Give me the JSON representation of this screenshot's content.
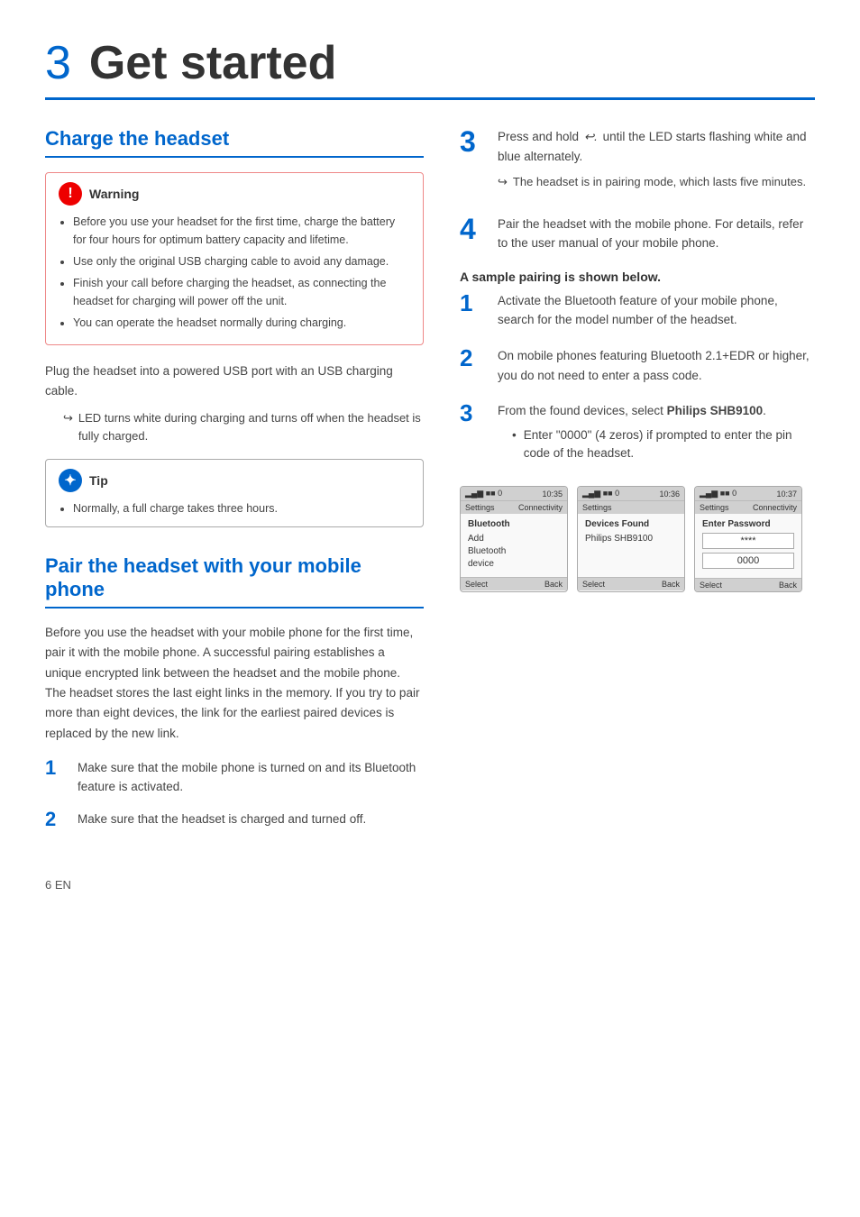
{
  "page": {
    "chapter": "3",
    "title": "Get started",
    "footer": "6    EN"
  },
  "charge_section": {
    "title": "Charge the headset",
    "warning": {
      "header": "Warning",
      "items": [
        "Before you use your headset for the first time, charge the battery for four hours for optimum battery capacity and lifetime.",
        "Use only the original USB charging cable to avoid any damage.",
        "Finish your call before charging the headset, as connecting the headset for charging will power off the unit.",
        "You can operate the headset normally during charging."
      ]
    },
    "body_text": "Plug the headset into a powered USB port with an USB charging cable.",
    "arrow_text": "LED turns white during charging and turns off when the headset is fully charged.",
    "tip": {
      "header": "Tip",
      "items": [
        "Normally, a full charge takes three hours."
      ]
    }
  },
  "right_steps": {
    "step3": {
      "num": "3",
      "text": "Press and hold",
      "icon_symbol": "↩",
      "text2": "until the LED starts flashing white and blue alternately.",
      "arrow": "The headset is in pairing mode, which lasts five minutes."
    },
    "step4": {
      "num": "4",
      "text": "Pair the headset with the mobile phone. For details, refer to the user manual of your mobile phone."
    },
    "sample_heading": "A sample pairing is shown below.",
    "sample_steps": [
      {
        "num": "1",
        "text": "Activate the Bluetooth feature of your mobile phone, search for the model number of the headset."
      },
      {
        "num": "2",
        "text": "On mobile phones featuring Bluetooth 2.1+EDR or higher, you do not need to enter a pass code."
      },
      {
        "num": "3",
        "text": "From the found devices, select",
        "bold_text": "Philips SHB9100",
        "text_after": "."
      }
    ],
    "pin_bullet": "Enter \"0000\" (4 zeros) if prompted to enter the pin code of the headset.",
    "phones": [
      {
        "time": "10:35",
        "nav_left": "Settings",
        "nav_right": "Connectivity",
        "section": "Bluetooth",
        "body_lines": [
          "Add",
          "Bluetooth",
          "device"
        ],
        "footer_left": "Select",
        "footer_right": "Back"
      },
      {
        "time": "10:36",
        "nav_left": "Settings",
        "nav_right": "",
        "section": "Devices Found",
        "body_lines": [
          "Philips SHB9100"
        ],
        "footer_left": "Select",
        "footer_right": "Back"
      },
      {
        "time": "10:37",
        "nav_left": "Settings",
        "nav_right": "Connectivity",
        "section": "",
        "body_title": "Enter Password",
        "body_masked": "****",
        "body_code": "0000",
        "footer_left": "Select",
        "footer_right": "Back"
      }
    ]
  },
  "pair_section": {
    "title": "Pair the headset with your mobile phone",
    "intro": "Before you use the headset with your mobile phone for the first time, pair it with the mobile phone. A successful pairing establishes a unique encrypted link between the headset and the mobile phone. The headset stores the last eight links in the memory. If you try to pair more than eight devices, the link for the earliest paired devices is replaced by the new link.",
    "steps": [
      {
        "num": "1",
        "text": "Make sure that the mobile phone is turned on and its Bluetooth feature is activated."
      },
      {
        "num": "2",
        "text": "Make sure that the headset is charged and turned off."
      }
    ]
  },
  "icons": {
    "warning_symbol": "!",
    "tip_symbol": "✦",
    "arrow_right": "↪"
  }
}
